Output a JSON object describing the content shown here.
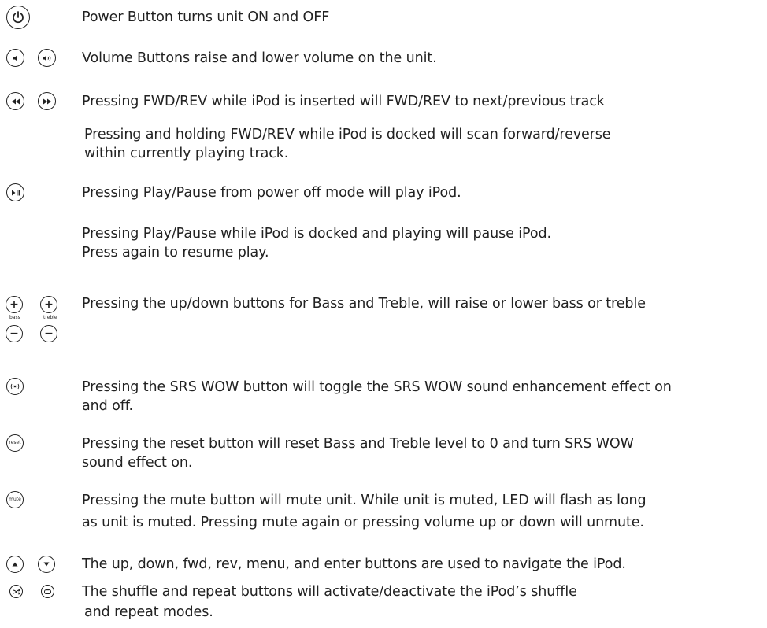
{
  "rows": {
    "power": "Power Button turns unit ON and OFF",
    "volume": "Volume Buttons raise and lower volume on the unit.",
    "fwdrev_1": "Pressing FWD/REV while iPod is inserted will FWD/REV to next/previous track",
    "fwdrev_2a": "Pressing and holding FWD/REV while iPod is  docked will scan forward/reverse",
    "fwdrev_2b": "within currently playing track.",
    "play_1": "Pressing Play/Pause from power off mode will play iPod.",
    "play_2a": "Pressing Play/Pause while iPod is docked and playing will pause iPod.",
    "play_2b": "Press again to resume play.",
    "bass_treble": "Pressing the up/down buttons for Bass and Treble, will raise or lower bass or treble",
    "srs_a": "Pressing the SRS WOW button will toggle the SRS WOW sound enhancement effect on",
    "srs_b": "and off.",
    "reset_a": "Pressing the reset button will reset Bass and Treble level to 0 and turn SRS WOW",
    "reset_b": "sound effect on.",
    "mute_a": "Pressing the mute button will mute unit. While unit is muted, LED will flash as long",
    "mute_b": "as unit is muted. Pressing mute again or pressing volume up or down will unmute.",
    "nav": "The up, down, fwd, rev, menu, and enter buttons are used to navigate the iPod.",
    "shuffle_a": "The shuffle and  repeat buttons will activate/deactivate the iPod’s shuffle",
    "shuffle_b": "and repeat modes."
  },
  "icon_labels": {
    "bass": "bass",
    "treble": "treble",
    "plus": "+",
    "minus": "−",
    "reset": "reset",
    "mute": "mute"
  },
  "colors": {
    "text": "#222222",
    "background": "#ffffff"
  }
}
